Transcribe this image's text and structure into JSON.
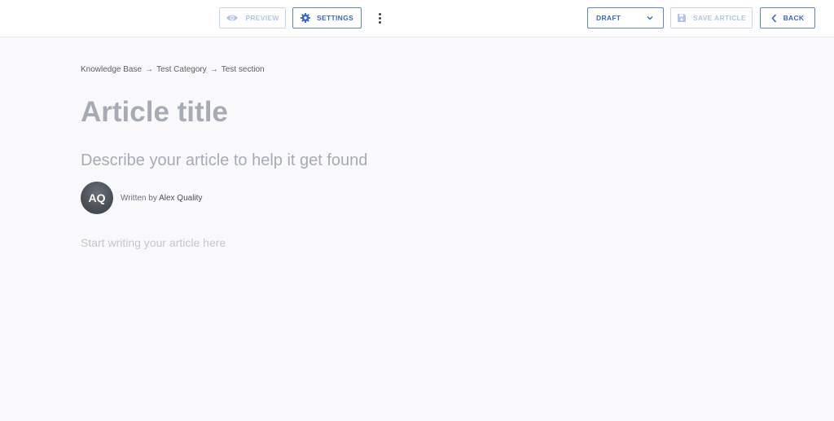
{
  "toolbar": {
    "preview_label": "PREVIEW",
    "settings_label": "SETTINGS",
    "status_label": "DRAFT",
    "save_label": "SAVE ARTICLE",
    "back_label": "BACK"
  },
  "breadcrumb": {
    "items": [
      "Knowledge Base",
      "Test Category",
      "Test section"
    ],
    "separator": "→"
  },
  "article": {
    "title_placeholder": "Article title",
    "description_placeholder": "Describe your article to help it get found",
    "written_by_prefix": "Written by",
    "author_name": "Alex Quality",
    "author_initials": "AQ",
    "body_placeholder": "Start writing your article here"
  },
  "icons": {
    "preview": "eye-icon",
    "settings": "gear-icon",
    "status": "chevron-down-icon",
    "save": "floppy-disk-icon",
    "back": "chevron-left-icon",
    "more": "kebab-menu-icon"
  },
  "colors": {
    "accent": "#3c66c4",
    "accent_border": "#5b84d6",
    "disabled": "#b3c3e6",
    "background": "#f9f9fb",
    "placeholder_text": "#a6abb5"
  }
}
